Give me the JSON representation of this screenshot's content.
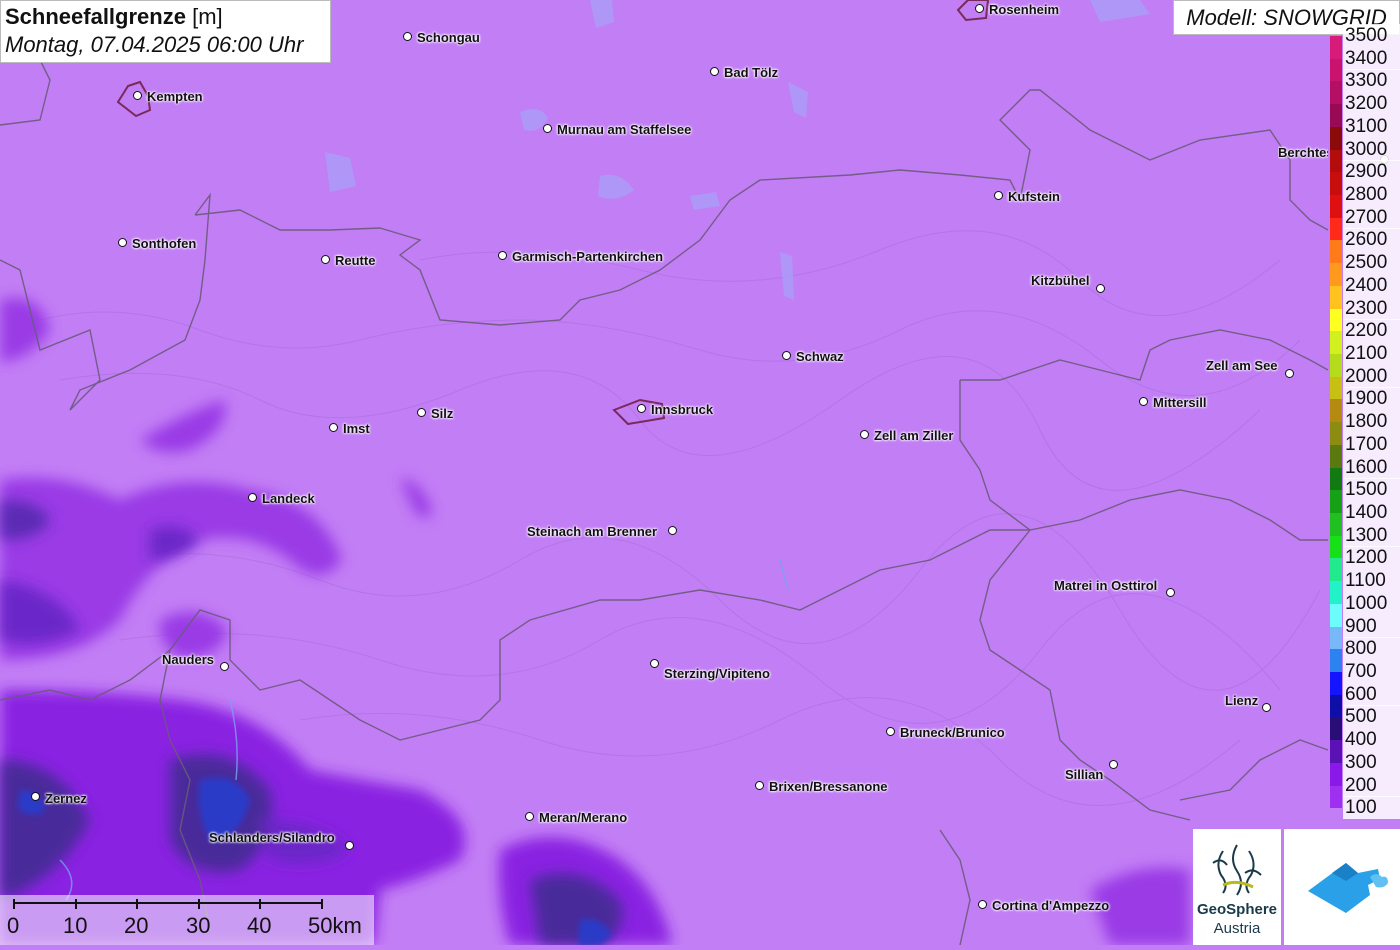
{
  "header": {
    "title_bold": "Schneefallgrenze",
    "title_unit": "[m]",
    "datetime": "Montag, 07.04.2025 06:00 Uhr"
  },
  "model": {
    "label": "Modell: SNOWGRID"
  },
  "legend": {
    "items": [
      {
        "label": "3500",
        "color": "#d81b7a"
      },
      {
        "label": "3400",
        "color": "#c9136f"
      },
      {
        "label": "3300",
        "color": "#b40f64"
      },
      {
        "label": "3200",
        "color": "#990a55"
      },
      {
        "label": "3100",
        "color": "#8b0a0a"
      },
      {
        "label": "3000",
        "color": "#b30c0c"
      },
      {
        "label": "2900",
        "color": "#c80d0d"
      },
      {
        "label": "2800",
        "color": "#de1010"
      },
      {
        "label": "2700",
        "color": "#ff2a1a"
      },
      {
        "label": "2600",
        "color": "#ff7a18"
      },
      {
        "label": "2500",
        "color": "#ff9a1e"
      },
      {
        "label": "2400",
        "color": "#ffc21e"
      },
      {
        "label": "2300",
        "color": "#ffff20"
      },
      {
        "label": "2200",
        "color": "#d2f01e"
      },
      {
        "label": "2100",
        "color": "#b4dc1a"
      },
      {
        "label": "2000",
        "color": "#c7bf14"
      },
      {
        "label": "1900",
        "color": "#b48a10"
      },
      {
        "label": "1800",
        "color": "#8c8c10"
      },
      {
        "label": "1700",
        "color": "#5a7a10"
      },
      {
        "label": "1600",
        "color": "#127a12"
      },
      {
        "label": "1500",
        "color": "#16a016"
      },
      {
        "label": "1400",
        "color": "#20c020"
      },
      {
        "label": "1300",
        "color": "#18e018"
      },
      {
        "label": "1200",
        "color": "#20ea8c"
      },
      {
        "label": "1100",
        "color": "#22f2c8"
      },
      {
        "label": "1000",
        "color": "#6cfcfc"
      },
      {
        "label": "900",
        "color": "#78b8f8"
      },
      {
        "label": "800",
        "color": "#2e82f0"
      },
      {
        "label": "700",
        "color": "#1414ff"
      },
      {
        "label": "600",
        "color": "#0e0ea8"
      },
      {
        "label": "500",
        "color": "#2a0e78"
      },
      {
        "label": "400",
        "color": "#5a12b4"
      },
      {
        "label": "300",
        "color": "#8a18e8"
      },
      {
        "label": "200",
        "color": "#a030f0"
      },
      {
        "label": "100",
        "color": "#c27ef5"
      }
    ]
  },
  "places": [
    {
      "name": "Rosenheim"
    },
    {
      "name": "Schongau"
    },
    {
      "name": "Kempten"
    },
    {
      "name": "Bad Tölz"
    },
    {
      "name": "Murnau am Staffelsee"
    },
    {
      "name": "Berchtesgaden"
    },
    {
      "name": "Kufstein"
    },
    {
      "name": "Sonthofen"
    },
    {
      "name": "Reutte"
    },
    {
      "name": "Garmisch-Partenkirchen"
    },
    {
      "name": "Kitzbühel"
    },
    {
      "name": "Schwaz"
    },
    {
      "name": "Zell am See"
    },
    {
      "name": "Mittersill"
    },
    {
      "name": "Innsbruck"
    },
    {
      "name": "Silz"
    },
    {
      "name": "Imst"
    },
    {
      "name": "Zell am Ziller"
    },
    {
      "name": "Landeck"
    },
    {
      "name": "Steinach am Brenner"
    },
    {
      "name": "Matrei in Osttirol"
    },
    {
      "name": "Nauders"
    },
    {
      "name": "Sterzing/Vipiteno"
    },
    {
      "name": "Lienz"
    },
    {
      "name": "Bruneck/Brunico"
    },
    {
      "name": "Sillian"
    },
    {
      "name": "Zernez"
    },
    {
      "name": "Brixen/Bressanone"
    },
    {
      "name": "Meran/Merano"
    },
    {
      "name": "Schlanders/Silandro"
    },
    {
      "name": "Cortina d'Ampezzo"
    }
  ],
  "scale": {
    "labels": [
      "0",
      "10",
      "20",
      "30",
      "40",
      "50km"
    ]
  },
  "logos": {
    "geosphere_name": "GeoSphere",
    "geosphere_sub": "Austria"
  }
}
